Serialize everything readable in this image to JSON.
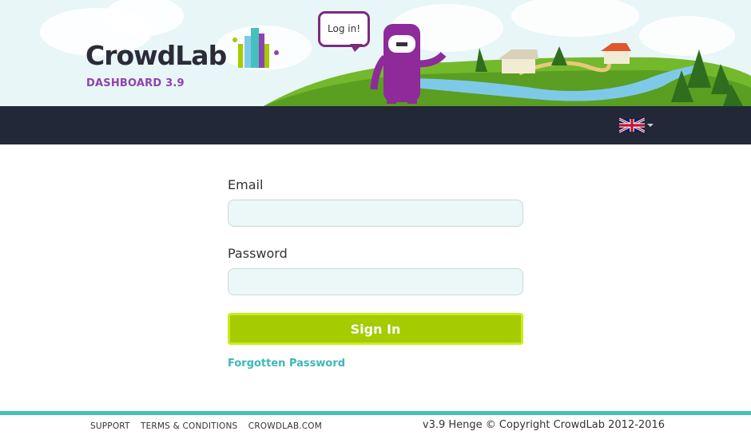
{
  "brand": {
    "name": "CrowdLab",
    "subtitle": "DASHBOARD 3.9",
    "accent_purple": "#8e44ad",
    "accent_green": "#a4cc00",
    "accent_teal": "#45c1bd"
  },
  "header": {
    "speech_bubble": "Log in!"
  },
  "navbar": {
    "language_icon": "uk-flag-icon",
    "language_caret_icon": "caret-down-icon"
  },
  "form": {
    "email_label": "Email",
    "email_value": "",
    "password_label": "Password",
    "password_value": "",
    "signin_label": "Sign In",
    "forgot_label": "Forgotten Password"
  },
  "footer": {
    "links": [
      "SUPPORT",
      "TERMS & CONDITIONS",
      "CROWDLAB.COM"
    ],
    "copyright": "v3.9 Henge © Copyright CrowdLab 2012-2016"
  }
}
